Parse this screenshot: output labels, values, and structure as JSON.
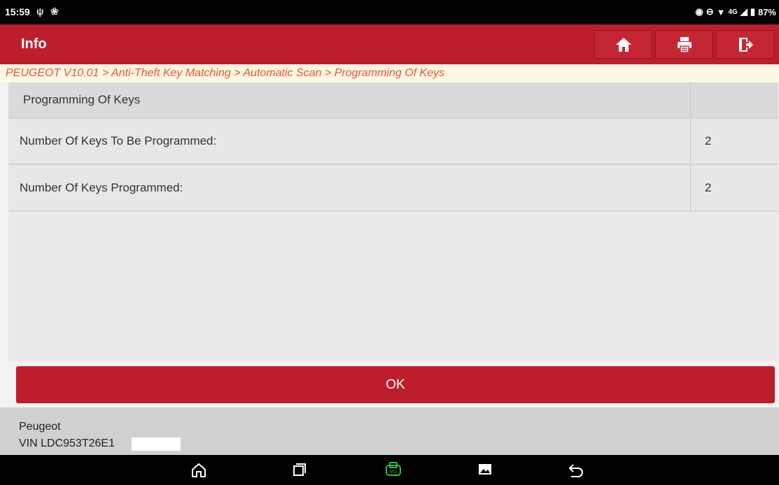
{
  "status": {
    "time": "15:59",
    "network": "4G",
    "battery": "87%"
  },
  "header": {
    "title": "Info"
  },
  "breadcrumb": "PEUGEOT V10.01 > Anti-Theft Key Matching > Automatic Scan > Programming Of Keys",
  "table": {
    "header": "Programming Of Keys",
    "rows": [
      {
        "label": "Number Of Keys To Be Programmed:",
        "value": "2"
      },
      {
        "label": "Number Of Keys Programmed:",
        "value": "2"
      }
    ]
  },
  "ok_label": "OK",
  "footer": {
    "make": "Peugeot",
    "vin": "VIN LDC953T26E1"
  },
  "colors": {
    "accent": "#bd1e2c",
    "breadcrumb": "#e8562a",
    "vci": "#2fbf4a"
  }
}
